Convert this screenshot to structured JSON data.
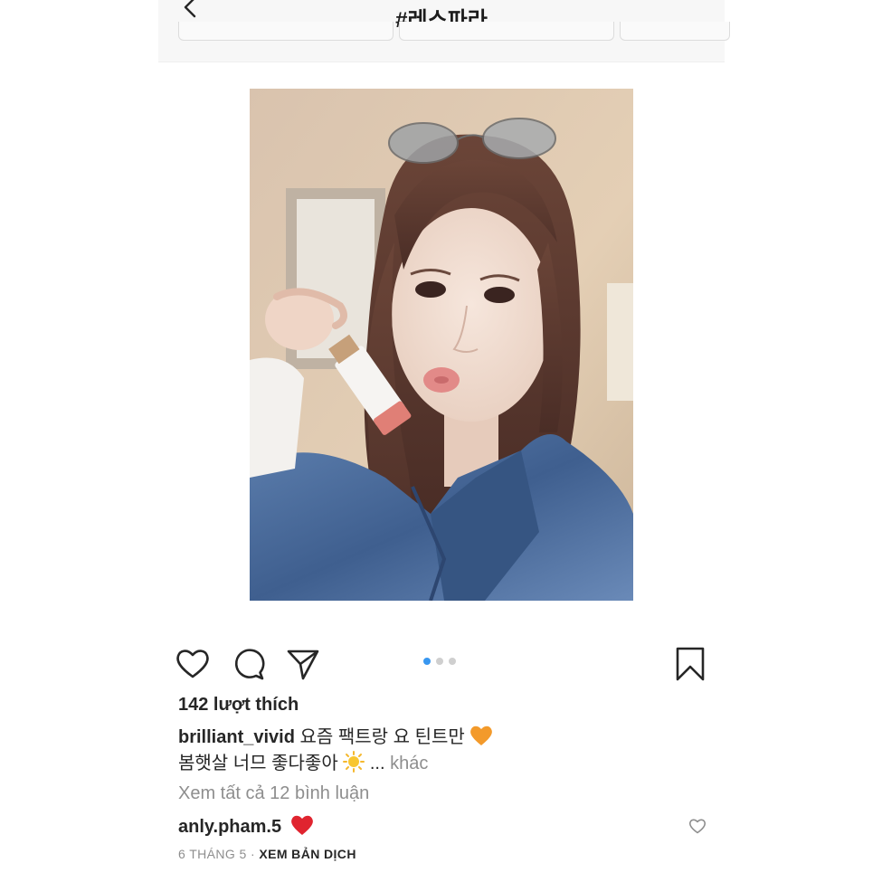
{
  "header": {
    "title": "#레스파라"
  },
  "post": {
    "likes": "142 lượt thích",
    "caption": {
      "username": "brilliant_vivid",
      "line1": "요즘 팩트랑 요 틴트만",
      "line2": "봄햇살 너므 좋다좋아",
      "ellipsis": "...",
      "more": "khác"
    },
    "view_comments": "Xem tất cả 12 bình luận",
    "comment": {
      "username": "anly.pham.5"
    },
    "date": "6 THÁNG 5",
    "separator": " · ",
    "translate": "XEM BẢN DỊCH",
    "carousel": {
      "count": 3,
      "active_index": 0
    }
  },
  "colors": {
    "accent": "#3897f0",
    "heart": "#ed4956"
  },
  "icons": [
    "back-arrow-icon",
    "heart-icon",
    "comment-icon",
    "share-icon",
    "bookmark-icon",
    "orange-heart-emoji",
    "sun-emoji",
    "red-heart-emoji",
    "small-heart-icon"
  ]
}
